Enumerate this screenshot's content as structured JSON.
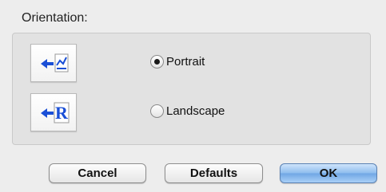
{
  "orientation": {
    "label": "Orientation:",
    "options": [
      {
        "label": "Portrait",
        "selected": true,
        "icon": "portrait-orientation-icon"
      },
      {
        "label": "Landscape",
        "selected": false,
        "icon": "landscape-orientation-icon"
      }
    ]
  },
  "buttons": {
    "cancel": "Cancel",
    "defaults": "Defaults",
    "ok": "OK"
  },
  "colors": {
    "accent_arrow": "#1a4fd6",
    "ok_button": "#8dbcee"
  }
}
